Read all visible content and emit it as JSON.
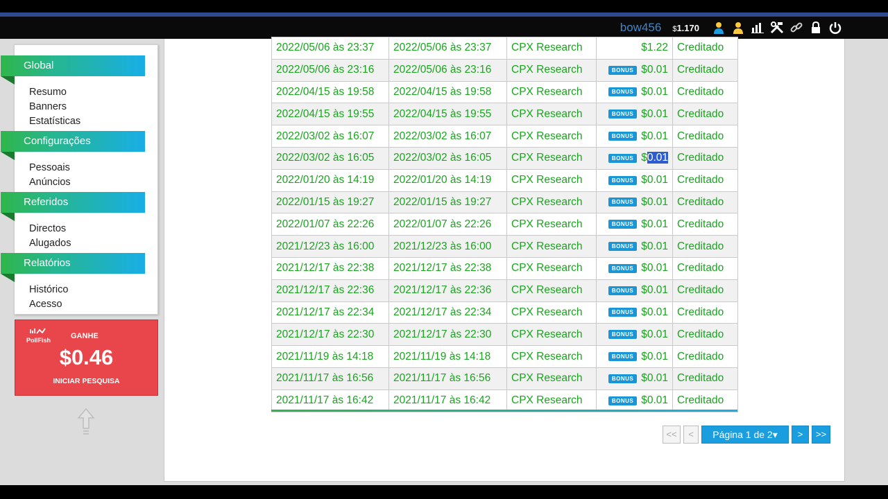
{
  "header": {
    "username": "bow456",
    "balance_symbol": "$",
    "balance": "1.170",
    "icons": [
      "user-icon",
      "referral-user-icon",
      "stats-chart-icon",
      "tools-icon",
      "link-icon",
      "lock-icon",
      "power-icon"
    ]
  },
  "sidebar": {
    "sections": [
      {
        "title": "Global",
        "items": [
          "Resumo",
          "Banners",
          "Estatísticas"
        ]
      },
      {
        "title": "Configurações",
        "items": [
          "Pessoais",
          "Anúncios"
        ]
      },
      {
        "title": "Referidos",
        "items": [
          "Directos",
          "Alugados"
        ]
      },
      {
        "title": "Relatórios",
        "items": [
          "Histórico",
          "Acesso"
        ]
      }
    ]
  },
  "ad": {
    "logo_line1": "PollFish",
    "ganhe": "GANHE",
    "amount": "$0.46",
    "cta": "INICIAR PESQUISA"
  },
  "table": {
    "bonus_label": "BONUS",
    "rows": [
      {
        "date1": "2022/05/06 às 23:37",
        "date2": "2022/05/06 às 23:37",
        "source": "CPX Research",
        "bonus": false,
        "amount": "$1.22",
        "status": "Creditado"
      },
      {
        "date1": "2022/05/06 às 23:16",
        "date2": "2022/05/06 às 23:16",
        "source": "CPX Research",
        "bonus": true,
        "amount": "$0.01",
        "status": "Creditado"
      },
      {
        "date1": "2022/04/15 às 19:58",
        "date2": "2022/04/15 às 19:58",
        "source": "CPX Research",
        "bonus": true,
        "amount": "$0.01",
        "status": "Creditado"
      },
      {
        "date1": "2022/04/15 às 19:55",
        "date2": "2022/04/15 às 19:55",
        "source": "CPX Research",
        "bonus": true,
        "amount": "$0.01",
        "status": "Creditado"
      },
      {
        "date1": "2022/03/02 às 16:07",
        "date2": "2022/03/02 às 16:07",
        "source": "CPX Research",
        "bonus": true,
        "amount": "$0.01",
        "status": "Creditado"
      },
      {
        "date1": "2022/03/02 às 16:05",
        "date2": "2022/03/02 às 16:05",
        "source": "CPX Research",
        "bonus": true,
        "amount": "$0.01",
        "status": "Creditado",
        "selected": "0.01"
      },
      {
        "date1": "2022/01/20 às 14:19",
        "date2": "2022/01/20 às 14:19",
        "source": "CPX Research",
        "bonus": true,
        "amount": "$0.01",
        "status": "Creditado"
      },
      {
        "date1": "2022/01/15 às 19:27",
        "date2": "2022/01/15 às 19:27",
        "source": "CPX Research",
        "bonus": true,
        "amount": "$0.01",
        "status": "Creditado"
      },
      {
        "date1": "2022/01/07 às 22:26",
        "date2": "2022/01/07 às 22:26",
        "source": "CPX Research",
        "bonus": true,
        "amount": "$0.01",
        "status": "Creditado"
      },
      {
        "date1": "2021/12/23 às 16:00",
        "date2": "2021/12/23 às 16:00",
        "source": "CPX Research",
        "bonus": true,
        "amount": "$0.01",
        "status": "Creditado"
      },
      {
        "date1": "2021/12/17 às 22:38",
        "date2": "2021/12/17 às 22:38",
        "source": "CPX Research",
        "bonus": true,
        "amount": "$0.01",
        "status": "Creditado"
      },
      {
        "date1": "2021/12/17 às 22:36",
        "date2": "2021/12/17 às 22:36",
        "source": "CPX Research",
        "bonus": true,
        "amount": "$0.01",
        "status": "Creditado"
      },
      {
        "date1": "2021/12/17 às 22:34",
        "date2": "2021/12/17 às 22:34",
        "source": "CPX Research",
        "bonus": true,
        "amount": "$0.01",
        "status": "Creditado"
      },
      {
        "date1": "2021/12/17 às 22:30",
        "date2": "2021/12/17 às 22:30",
        "source": "CPX Research",
        "bonus": true,
        "amount": "$0.01",
        "status": "Creditado"
      },
      {
        "date1": "2021/11/19 às 14:18",
        "date2": "2021/11/19 às 14:18",
        "source": "CPX Research",
        "bonus": true,
        "amount": "$0.01",
        "status": "Creditado"
      },
      {
        "date1": "2021/11/17 às 16:56",
        "date2": "2021/11/17 às 16:56",
        "source": "CPX Research",
        "bonus": true,
        "amount": "$0.01",
        "status": "Creditado"
      },
      {
        "date1": "2021/11/17 às 16:42",
        "date2": "2021/11/17 às 16:42",
        "source": "CPX Research",
        "bonus": true,
        "amount": "$0.01",
        "status": "Creditado"
      }
    ]
  },
  "pagination": {
    "first": "<<",
    "prev": "<",
    "page_label": "Página 1 de 2",
    "next": ">",
    "last": ">>"
  },
  "colors": {
    "text_green": "#1aa41f",
    "accent_blue": "#1a9ee0",
    "ad_red": "#e8464a"
  }
}
